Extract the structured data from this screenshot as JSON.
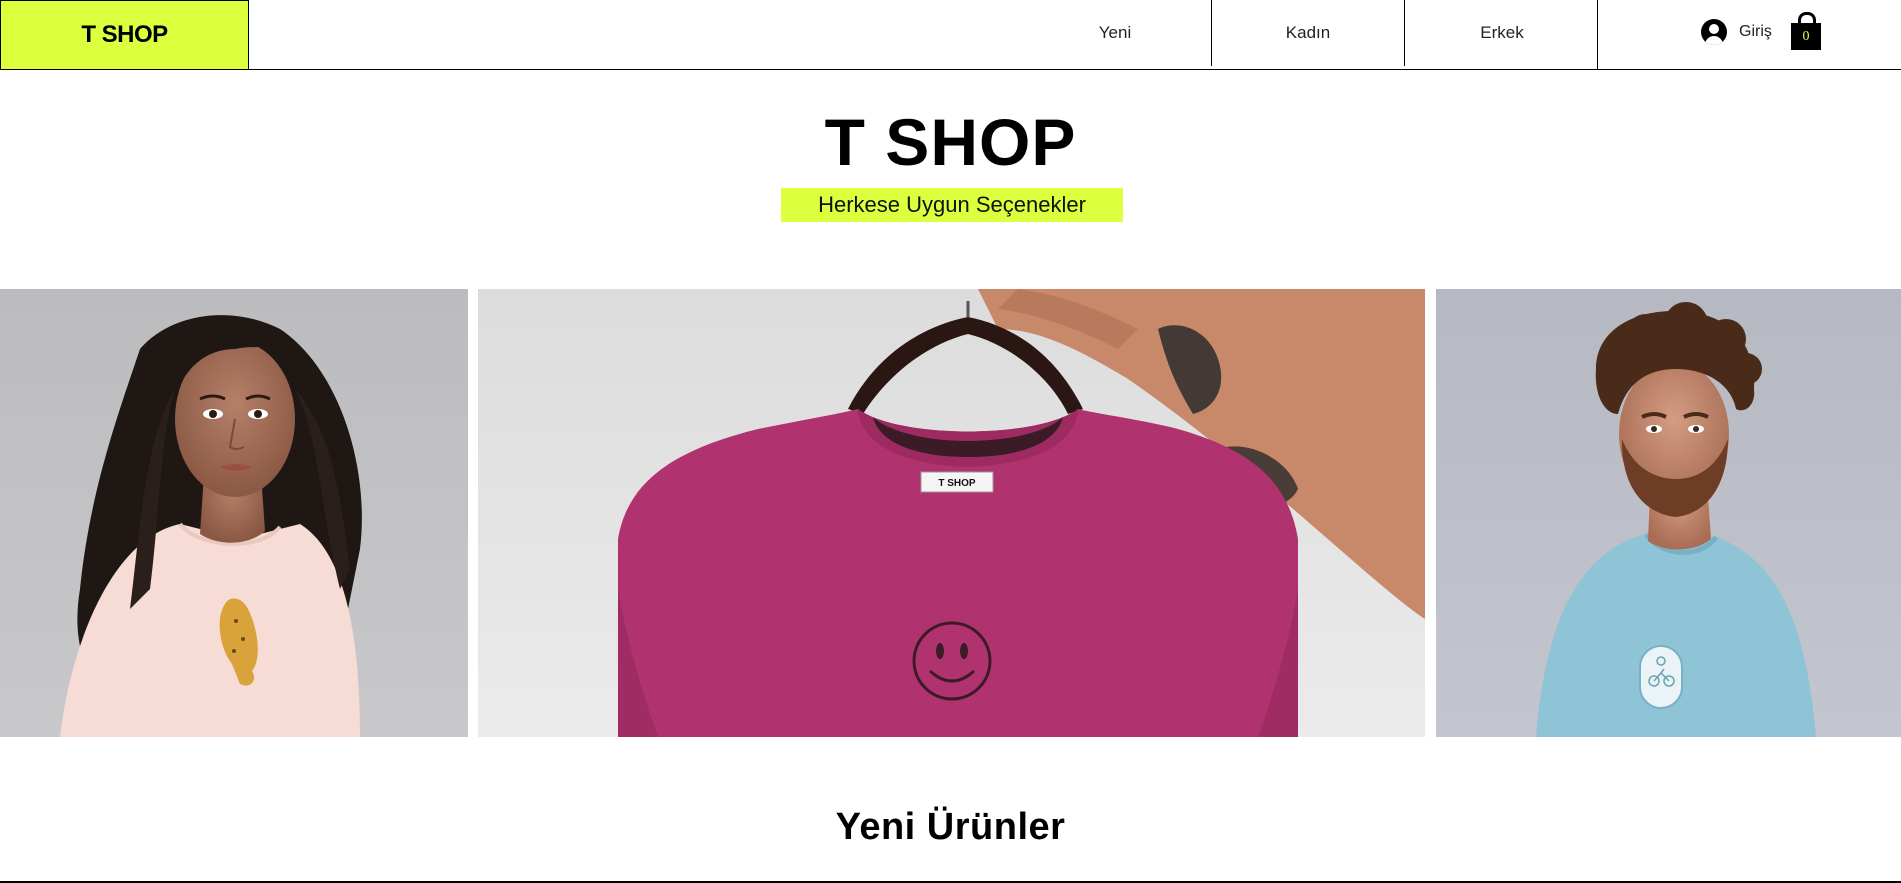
{
  "header": {
    "logo": "T SHOP",
    "nav": [
      {
        "label": "Yeni"
      },
      {
        "label": "Kadın"
      },
      {
        "label": "Erkek"
      }
    ],
    "login_label": "Giriş",
    "cart_count": "0"
  },
  "hero": {
    "title": "T SHOP",
    "tagline": "Herkese Uygun Seçenekler"
  },
  "gallery": {
    "tshirt_label": "T SHOP"
  },
  "section": {
    "title": "Yeni Ürünler"
  },
  "colors": {
    "accent": "#dcff3e",
    "text": "#000000"
  }
}
